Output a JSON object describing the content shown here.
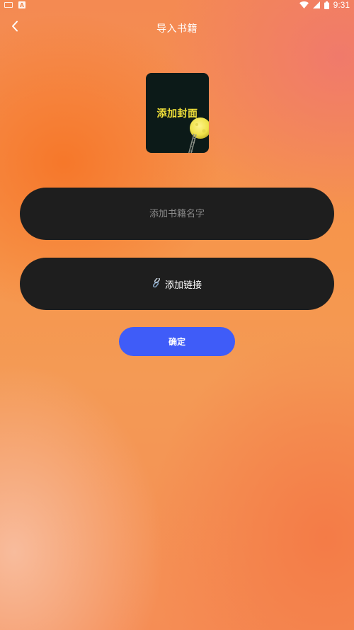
{
  "status_bar": {
    "time": "9:31",
    "a_badge": "A",
    "icons": [
      "keyboard-icon",
      "a-badge-icon",
      "wifi-icon",
      "signal-icon",
      "battery-icon"
    ]
  },
  "header": {
    "title": "导入书籍",
    "back_icon": "chevron-left-icon"
  },
  "cover": {
    "label": "添加封面",
    "icon": "moon-icon"
  },
  "book_name": {
    "placeholder": "添加书籍名字",
    "value": ""
  },
  "link": {
    "label": "添加链接",
    "icon": "link-icon"
  },
  "confirm": {
    "label": "确定"
  },
  "colors": {
    "pill_bg": "#1e1e1e",
    "confirm_bg": "#3f5cf8",
    "cover_bg": "#0c1a18",
    "cover_text": "#f3e23a"
  }
}
